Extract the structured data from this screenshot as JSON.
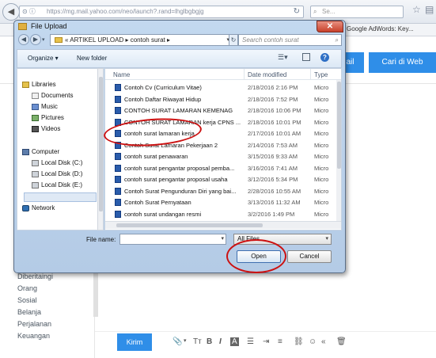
{
  "browser": {
    "back_icon": "back-arrow-icon",
    "url": "https://mg.mail.yahoo.com/neo/launch?.rand=lhglbgbgjg",
    "search_placeholder": "Se...",
    "bookmark": "Google AdWords: Key..."
  },
  "mail": {
    "btn_mail": "ail",
    "btn_search_web": "Cari di Web",
    "sidebar": [
      "Diberitaingi",
      "Orang",
      "Sosial",
      "Belanja",
      "Perjalanan",
      "Keuangan"
    ],
    "send": "Kirim",
    "toolbar_glyphs": [
      "📎",
      "▾",
      "Tт",
      "B",
      "I",
      "A",
      "☰",
      "⇥",
      "≡",
      "⛓",
      "☺",
      "«",
      "🗑"
    ]
  },
  "dialog": {
    "title": "File Upload",
    "close": "✕",
    "nav_back": "◀",
    "nav_fwd": "▶",
    "breadcrumb": "« ARTIKEL UPLOAD ▸ contoh surat ▸",
    "search_placeholder": "Search contoh surat",
    "organize": "Organize ▾",
    "new_folder": "New folder",
    "help": "?",
    "nav_pane": {
      "libraries": "Libraries",
      "documents": "Documents",
      "music": "Music",
      "pictures": "Pictures",
      "videos": "Videos",
      "computer": "Computer",
      "disk_c": "Local Disk (C:)",
      "disk_d": "Local Disk (D:)",
      "disk_e": "Local Disk (E:)",
      "network": "Network"
    },
    "columns": {
      "name": "Name",
      "date": "Date modified",
      "type": "Type"
    },
    "files": [
      {
        "name": "Contoh Cv (Curriculum Vitae)",
        "date": "2/18/2016 2:16 PM",
        "type": "Micro"
      },
      {
        "name": "Contoh Daftar Riwayat Hidup",
        "date": "2/18/2016 7:52 PM",
        "type": "Micro"
      },
      {
        "name": "CONTOH SURAT LAMARAN KEMENAG",
        "date": "2/18/2016 10:06 PM",
        "type": "Micro"
      },
      {
        "name": "CONTOH SURAT LAMARAN kerja CPNS ...",
        "date": "2/18/2016 10:01 PM",
        "type": "Micro"
      },
      {
        "name": "contoh surat lamaran kerja",
        "date": "2/17/2016 10:01 AM",
        "type": "Micro"
      },
      {
        "name": "Contoh Surat Lamaran Pekerjaan 2",
        "date": "2/14/2016 7:53 AM",
        "type": "Micro"
      },
      {
        "name": "contoh surat penawaran",
        "date": "3/15/2016 9:33 AM",
        "type": "Micro"
      },
      {
        "name": "contoh surat pengantar proposal pemba...",
        "date": "3/16/2016 7:41 AM",
        "type": "Micro"
      },
      {
        "name": "contoh surat pengantar proposal usaha",
        "date": "3/12/2016 5:34 PM",
        "type": "Micro"
      },
      {
        "name": "Contoh Surat Pengunduran Diri  yang bai...",
        "date": "2/28/2016 10:55 AM",
        "type": "Micro"
      },
      {
        "name": "Contoh Surat Pernyataan",
        "date": "3/13/2016 11:32 AM",
        "type": "Micro"
      },
      {
        "name": "contoh surat undangan resmi",
        "date": "3/2/2016 1:49 PM",
        "type": "Micro"
      }
    ],
    "file_name_label": "File name:",
    "file_name_value": "",
    "filter": "All Files",
    "open": "Open",
    "cancel": "Cancel"
  }
}
